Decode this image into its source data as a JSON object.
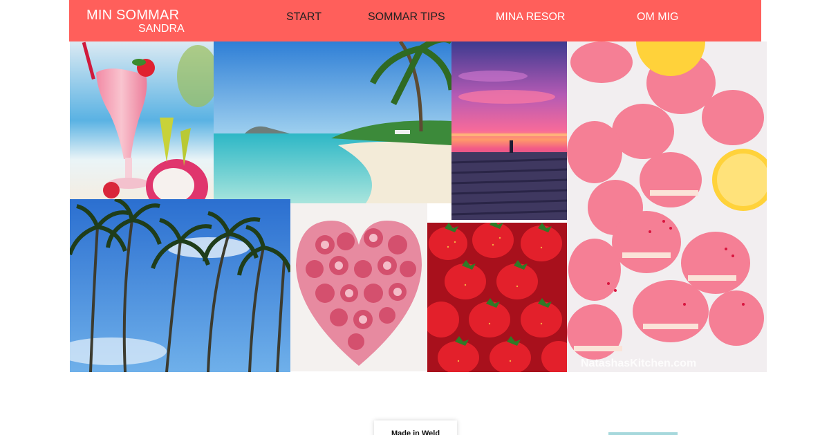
{
  "header": {
    "title": "MIN SOMMAR",
    "subtitle": "SANDRA",
    "bg_color": "#ff5f5b"
  },
  "nav": [
    {
      "label": "START"
    },
    {
      "label": "SOMMAR TIPS"
    },
    {
      "label": "MINA RESOR"
    },
    {
      "label": "OM MIG"
    }
  ],
  "gallery": {
    "macarons_watermark": "NatashasKitchen.com"
  },
  "footer": {
    "badge": "Made in Weld",
    "accent_color": "#a6d8dc"
  }
}
